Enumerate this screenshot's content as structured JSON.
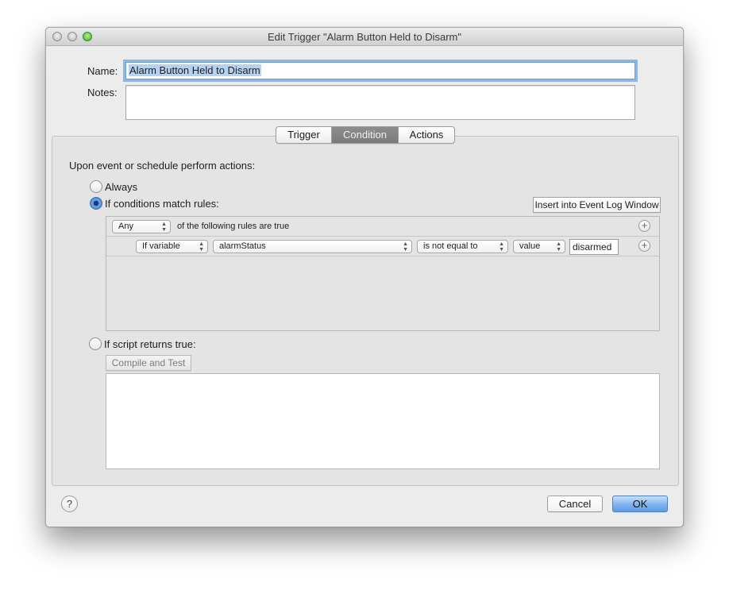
{
  "window": {
    "title": "Edit Trigger \"Alarm Button Held to Disarm\""
  },
  "form": {
    "name_label": "Name:",
    "name_value": "Alarm Button Held to Disarm",
    "notes_label": "Notes:",
    "notes_value": ""
  },
  "tabs": [
    {
      "label": "Trigger",
      "active": false
    },
    {
      "label": "Condition",
      "active": true
    },
    {
      "label": "Actions",
      "active": false
    }
  ],
  "condition": {
    "intro": "Upon event or schedule perform actions:",
    "always_label": "Always",
    "always_selected": false,
    "rules_label": "If conditions match rules:",
    "rules_selected": true,
    "insert_button": "Insert into Event Log Window",
    "match_popup": "Any",
    "match_text": "of the following rules are true",
    "rule": {
      "type_popup": "If variable",
      "variable_popup": "alarmStatus",
      "operator_popup": "is not equal to",
      "compare_popup": "value",
      "value": "disarmed"
    },
    "script_label": "If script returns true:",
    "script_selected": false,
    "compile_button": "Compile and Test",
    "script_value": ""
  },
  "footer": {
    "help_label": "?",
    "cancel_button": "Cancel",
    "ok_button": "OK"
  },
  "colors": {
    "accent": "#3d7fd1",
    "active_tab": "#7f7f7f",
    "panel": "#e4e4e4"
  }
}
